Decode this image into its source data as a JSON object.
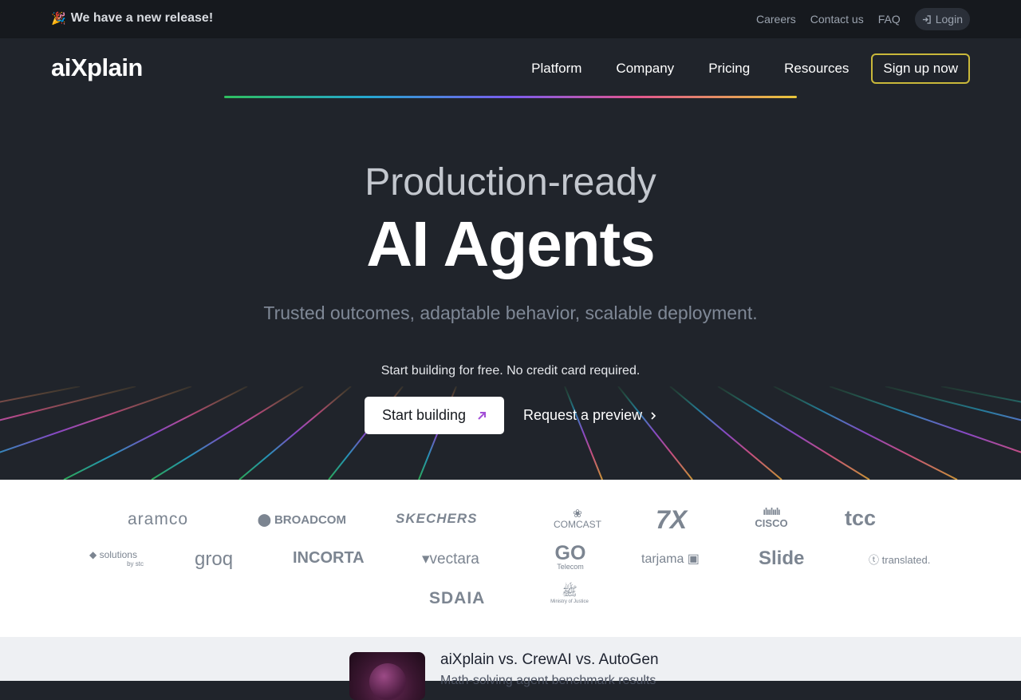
{
  "announcement": {
    "emoji": "🎉",
    "text": "We have a new release!"
  },
  "toplinks": {
    "careers": "Careers",
    "contact": "Contact us",
    "faq": "FAQ",
    "login": "Login"
  },
  "brand": {
    "logo": "aiXplain"
  },
  "nav": {
    "items": [
      "Platform",
      "Company",
      "Pricing",
      "Resources"
    ],
    "signup": "Sign up now"
  },
  "hero": {
    "subtitle": "Production-ready",
    "title": "AI Agents",
    "tagline": "Trusted outcomes, adaptable behavior, scalable deployment.",
    "note": "Start building for free. No credit card required.",
    "cta_primary": "Start building",
    "cta_secondary": "Request a preview"
  },
  "clients": {
    "row1": [
      "aramco",
      "BROADCOM",
      "SKECHERS",
      "COMCAST",
      "7X",
      "CISCO",
      "tcc"
    ],
    "row2": [
      "solutions",
      "by stc",
      "groq",
      "INCORTA",
      "vectara",
      "GO",
      "Telecom",
      "tarjama",
      "Slide",
      "translated."
    ],
    "row3": [
      "SDAIA",
      "Ministry of Justice"
    ]
  },
  "featured": {
    "title": "aiXplain vs. CrewAI vs. AutoGen",
    "subtitle": "Math-solving agent benchmark results"
  },
  "colors": {
    "accent_border": "#c9b83a",
    "background": "#20242b",
    "topbar": "#16191e"
  }
}
